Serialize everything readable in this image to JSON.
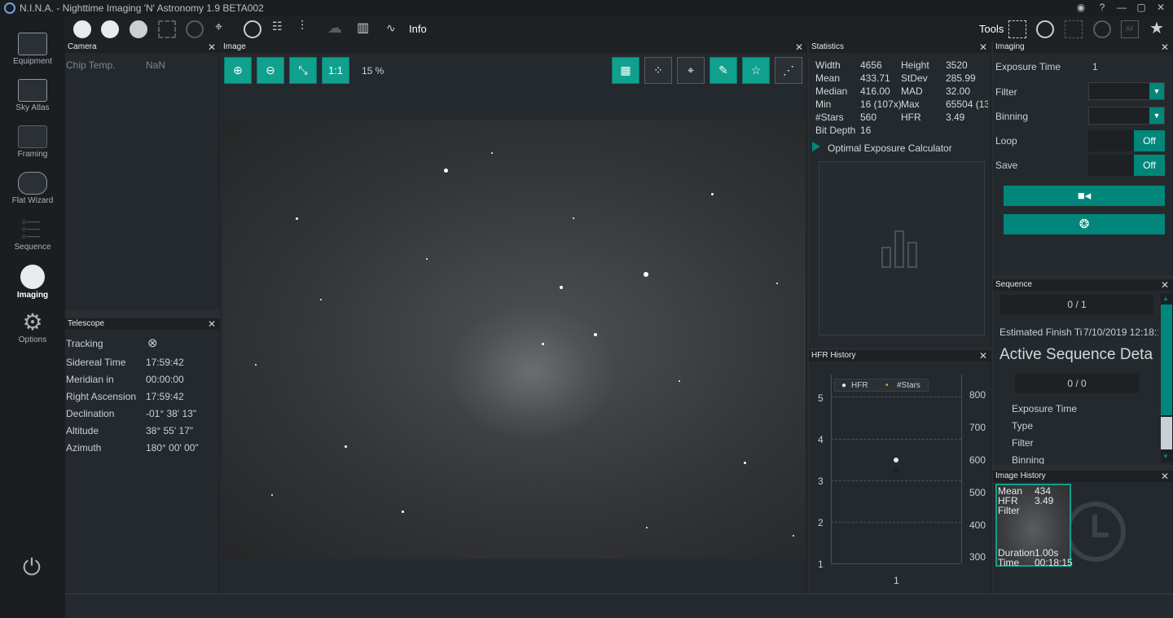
{
  "window": {
    "title": "N.I.N.A. - Nighttime Imaging 'N' Astronomy 1.9 BETA002"
  },
  "sidebar": {
    "items": [
      {
        "label": "Equipment"
      },
      {
        "label": "Sky Atlas"
      },
      {
        "label": "Framing"
      },
      {
        "label": "Flat Wizard"
      },
      {
        "label": "Sequence"
      },
      {
        "label": "Imaging"
      },
      {
        "label": "Options"
      }
    ]
  },
  "toolbar": {
    "info_label": "Info",
    "tools_label": "Tools"
  },
  "camera": {
    "header": "Camera",
    "rows": [
      {
        "label": "Chip Temp.",
        "value": "NaN"
      }
    ]
  },
  "telescope": {
    "header": "Telescope",
    "rows": [
      {
        "label": "Tracking",
        "value": "⊗"
      },
      {
        "label": "Sidereal Time",
        "value": "17:59:42"
      },
      {
        "label": "Meridian in",
        "value": "00:00:00"
      },
      {
        "label": "Right Ascension",
        "value": "17:59:42"
      },
      {
        "label": "Declination",
        "value": "-01° 38' 13\""
      },
      {
        "label": "Altitude",
        "value": "38° 55' 17\""
      },
      {
        "label": "Azimuth",
        "value": "180° 00' 00\""
      }
    ]
  },
  "image": {
    "header": "Image",
    "one_to_one": "1:1",
    "zoom": "15 %"
  },
  "statistics": {
    "header": "Statistics",
    "rows": [
      {
        "l1": "Width",
        "v1": "4656",
        "l2": "Height",
        "v2": "3520"
      },
      {
        "l1": "Mean",
        "v1": "433.71",
        "l2": "StDev",
        "v2": "285.99"
      },
      {
        "l1": "Median",
        "v1": "416.00",
        "l2": "MAD",
        "v2": "32.00"
      },
      {
        "l1": "Min",
        "v1": "16 (107x)",
        "l2": "Max",
        "v2": "65504 (13"
      },
      {
        "l1": "#Stars",
        "v1": "560",
        "l2": "HFR",
        "v2": "3.49"
      },
      {
        "l1": "Bit Depth",
        "v1": "16",
        "l2": "",
        "v2": ""
      }
    ],
    "calculator": "Optimal Exposure Calculator"
  },
  "hfr_history": {
    "header": "HFR History",
    "legend_hfr": "HFR",
    "legend_stars": "#Stars",
    "y_left": [
      "5",
      "4",
      "3",
      "2",
      "1"
    ],
    "y_right": [
      "800",
      "700",
      "600",
      "500",
      "400",
      "300"
    ],
    "x_label": "1"
  },
  "imaging": {
    "header": "Imaging",
    "exposure_label": "Exposure Time",
    "exposure_value": "1",
    "filter_label": "Filter",
    "binning_label": "Binning",
    "loop_label": "Loop",
    "loop_value": "Off",
    "save_label": "Save",
    "save_value": "Off"
  },
  "sequence": {
    "header": "Sequence",
    "progress": "0 / 1",
    "finish_label": "Estimated Finish Ti",
    "finish_value": "7/10/2019 12:18:1",
    "active_title": "Active Sequence Deta",
    "active_progress": "0 / 0",
    "fields": [
      "Exposure Time",
      "Type",
      "Filter",
      "Binning"
    ]
  },
  "image_history": {
    "header": "Image History",
    "mean_label": "Mean",
    "mean_value": "434",
    "hfr_label": "HFR",
    "hfr_value": "3.49",
    "filter_label": "Filter",
    "duration_label": "Duration",
    "duration_value": "1.00s",
    "time_label": "Time",
    "time_value": "00:18:15"
  },
  "colors": {
    "accent": "#00867a",
    "bg": "#24292d",
    "dark": "#1b1d20"
  }
}
